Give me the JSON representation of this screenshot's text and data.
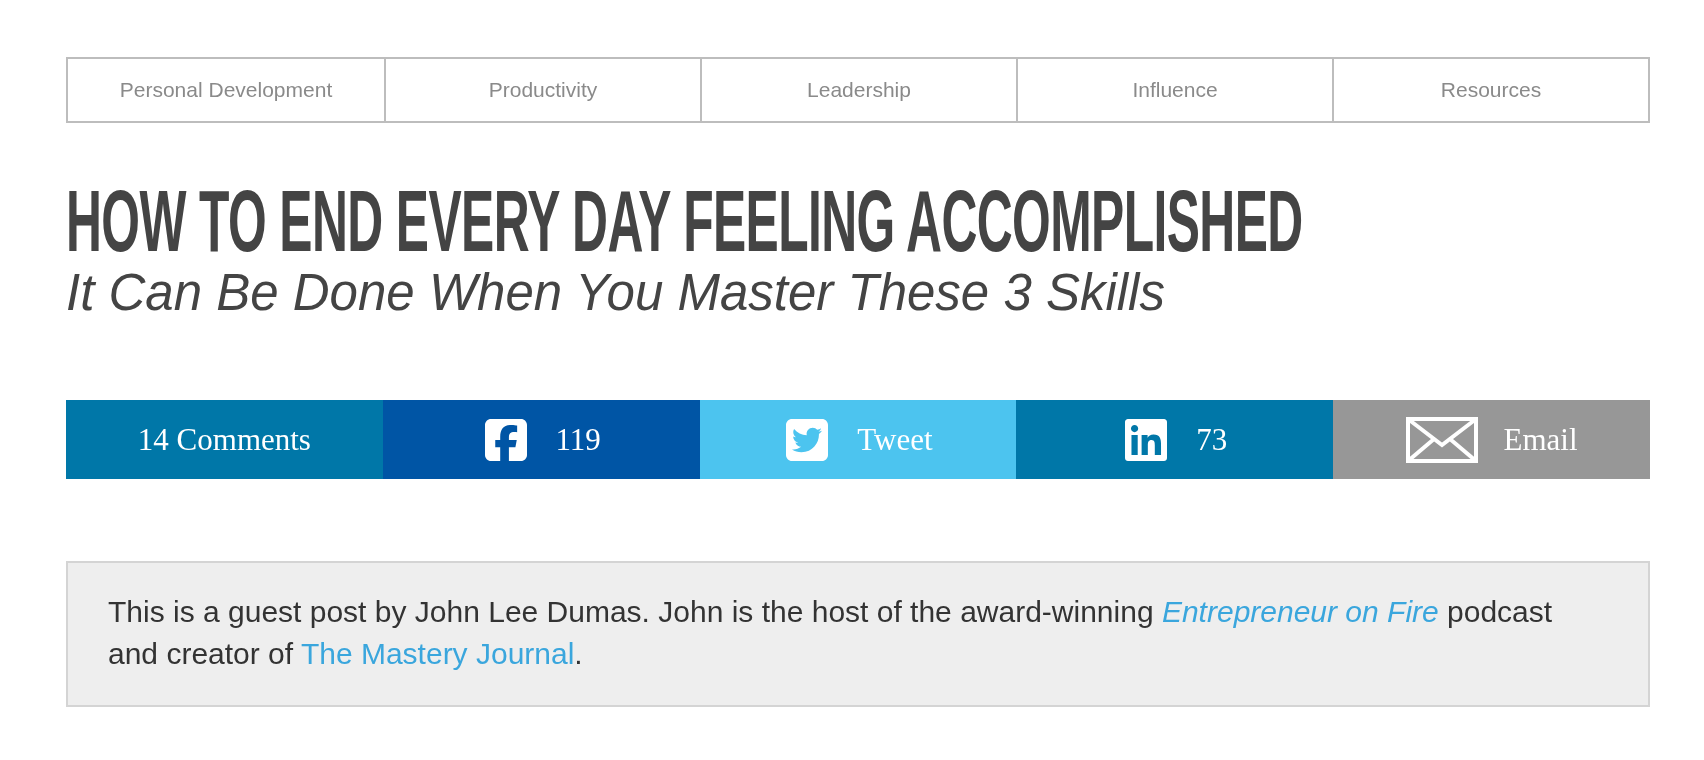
{
  "nav": [
    {
      "label": "Personal Development"
    },
    {
      "label": "Productivity"
    },
    {
      "label": "Leadership"
    },
    {
      "label": "Influence"
    },
    {
      "label": "Resources"
    }
  ],
  "title": "HOW TO END EVERY DAY FEELING ACCOMPLISHED",
  "subtitle": "It Can Be Done When You Master These 3 Skills",
  "share": [
    {
      "kind": "comments",
      "label": "14 Comments",
      "color": "#0077a8"
    },
    {
      "kind": "facebook",
      "label": "119",
      "color": "#0055a5"
    },
    {
      "kind": "twitter",
      "label": "Tweet",
      "color": "#4cc4ef"
    },
    {
      "kind": "linkedin",
      "label": "73",
      "color": "#0077a8"
    },
    {
      "kind": "email",
      "label": "Email",
      "color": "#979797"
    }
  ],
  "intro": [
    {
      "kind": "text",
      "text": "This is a guest post by John Lee Dumas. John is the host of the award-winning "
    },
    {
      "kind": "link",
      "text": "Entrepreneur on Fire",
      "italic": true
    },
    {
      "kind": "text",
      "text": " podcast and creator of "
    },
    {
      "kind": "link",
      "text": "The Mastery Journal",
      "italic": false
    },
    {
      "kind": "text",
      "text": "."
    }
  ]
}
